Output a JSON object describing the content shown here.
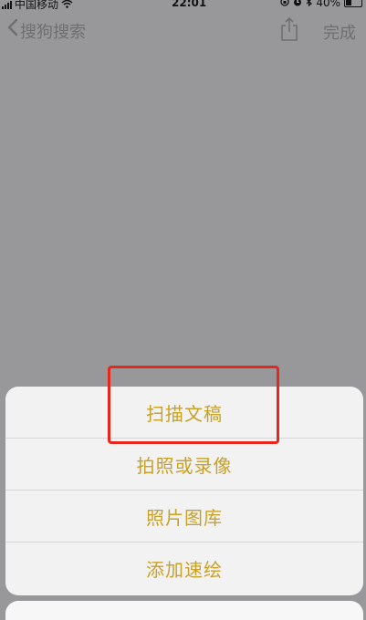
{
  "status_bar": {
    "carrier": "中国移动",
    "time": "22:01",
    "battery": "40%",
    "battery_level": 0.4,
    "icons": [
      "signal-icon",
      "wifi-icon",
      "lock-rotation-icon",
      "alarm-icon",
      "bluetooth-icon",
      "battery-icon"
    ]
  },
  "nav": {
    "back_label": "搜狗搜索",
    "done_label": "完成",
    "share_icon": "share-icon"
  },
  "action_sheet": {
    "items": [
      {
        "label": "扫描文稿"
      },
      {
        "label": "拍照或录像"
      },
      {
        "label": "照片图库"
      },
      {
        "label": "添加速绘"
      }
    ],
    "highlighted_item": "扫描文稿"
  },
  "colors": {
    "backdrop": "#98989b",
    "sheet_text": "#c8a126",
    "highlight": "#e8271c"
  }
}
